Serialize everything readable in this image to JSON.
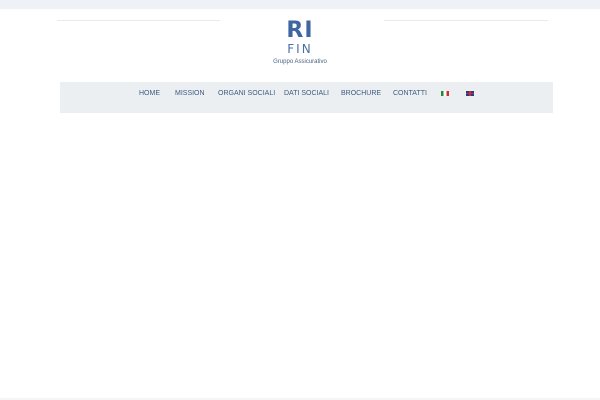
{
  "logo": {
    "top": "RI",
    "bottom": "FIN",
    "tagline": "Gruppo Assicurativo"
  },
  "nav": {
    "items": [
      {
        "label": "HOME"
      },
      {
        "label": "MISSION"
      },
      {
        "label": "ORGANI SOCIALI"
      },
      {
        "label": "DATI SOCIALI"
      },
      {
        "label": "BROCHURE"
      },
      {
        "label": "CONTATTI"
      }
    ],
    "flags": [
      {
        "icon": "italian-flag-icon"
      },
      {
        "icon": "uk-flag-icon"
      }
    ]
  },
  "colors": {
    "brand": "#3e66a0",
    "nav_text": "#3d5a80",
    "navbar_bg": "#eceff2"
  }
}
